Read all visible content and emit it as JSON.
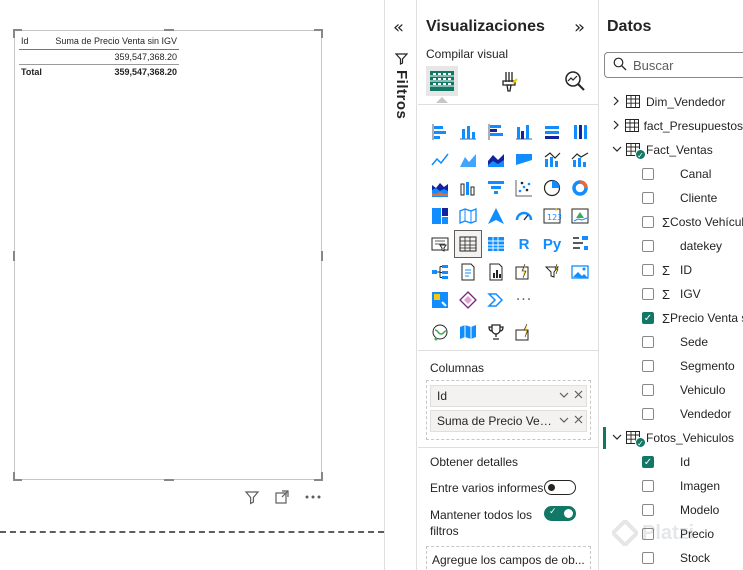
{
  "table_visual": {
    "header": {
      "col1": "Id",
      "col2": "Suma de Precio Venta sin IGV"
    },
    "rows": [
      {
        "col1": "",
        "col2": "359,547,368.20"
      }
    ],
    "total": {
      "col1": "Total",
      "col2": "359,547,368.20"
    }
  },
  "visual_toolbar": {
    "icons": [
      "filter-icon",
      "focus-mode-icon",
      "more-options-icon"
    ]
  },
  "filters_pane": {
    "label": "Filtros",
    "collapse_glyph": "«"
  },
  "visualizations_pane": {
    "title": "Visualizaciones",
    "expand_glyph": "»",
    "build_label": "Compilar visual",
    "tabs": [
      "build-visual-tab",
      "format-visual-tab",
      "analytics-tab"
    ],
    "r_label": "R",
    "py_label": "Py",
    "more_label": "···",
    "columns_label": "Columnas",
    "column_fields": [
      "Id",
      "Suma de Precio Venta..."
    ],
    "drillthrough_label": "Obtener detalles",
    "cross_report_label": "Entre varios informes",
    "cross_report_on": false,
    "keep_filters_label": "Mantener todos los filtros",
    "keep_filters_on": true,
    "drill_placeholder": "Agregue los campos de ob..."
  },
  "data_pane": {
    "title": "Datos",
    "search_placeholder": "Buscar",
    "tables": [
      {
        "name": "Dim_Vendedor",
        "expanded": false
      },
      {
        "name": "fact_Presupuestos",
        "expanded": false
      },
      {
        "name": "Fact_Ventas",
        "expanded": true,
        "has_selection": true,
        "fields": [
          {
            "name": "Canal",
            "sigma": false,
            "checked": false
          },
          {
            "name": "Cliente",
            "sigma": false,
            "checked": false
          },
          {
            "name": "Costo Vehículo",
            "sigma": true,
            "checked": false
          },
          {
            "name": "datekey",
            "sigma": false,
            "checked": false
          },
          {
            "name": "ID",
            "sigma": true,
            "checked": false
          },
          {
            "name": "IGV",
            "sigma": true,
            "checked": false
          },
          {
            "name": "Precio Venta sin IGV",
            "sigma": true,
            "checked": true
          },
          {
            "name": "Sede",
            "sigma": false,
            "checked": false
          },
          {
            "name": "Segmento",
            "sigma": false,
            "checked": false
          },
          {
            "name": "Vehiculo",
            "sigma": false,
            "checked": false
          },
          {
            "name": "Vendedor",
            "sigma": false,
            "checked": false
          }
        ]
      },
      {
        "name": "Fotos_Vehiculos",
        "expanded": true,
        "has_selection": true,
        "selected": true,
        "fields": [
          {
            "name": "Id",
            "sigma": false,
            "checked": true
          },
          {
            "name": "Imagen",
            "sigma": false,
            "checked": false
          },
          {
            "name": "Modelo",
            "sigma": false,
            "checked": false
          },
          {
            "name": "Precio",
            "sigma": false,
            "checked": false
          },
          {
            "name": "Stock",
            "sigma": false,
            "checked": false
          }
        ]
      }
    ]
  },
  "watermark": {
    "text": "Platzi"
  },
  "colors": {
    "accent": "#117865",
    "blue": "#118dff",
    "border": "#c8c6c4"
  }
}
